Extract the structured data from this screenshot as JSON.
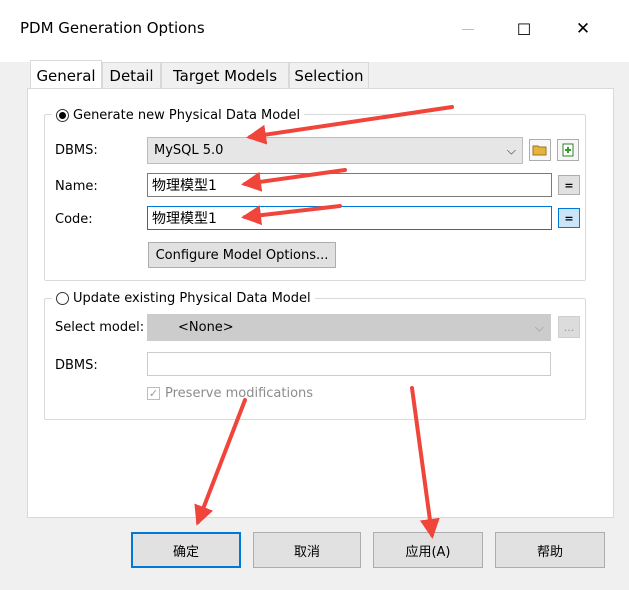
{
  "window": {
    "title": "PDM Generation Options",
    "controls": {
      "minimize": "—",
      "maximize": "☐",
      "close": "✕"
    }
  },
  "tabs": [
    {
      "label": "General"
    },
    {
      "label": "Detail"
    },
    {
      "label": "Target Models"
    },
    {
      "label": "Selection"
    }
  ],
  "generate_new": {
    "legend": "Generate new Physical Data Model",
    "selected": true,
    "dbms_label": "DBMS:",
    "dbms_value": "MySQL 5.0",
    "name_label": "Name:",
    "name_value": "物理模型1",
    "name_eq": "=",
    "code_label": "Code:",
    "code_value": "物理模型1",
    "code_eq": "=",
    "configure_button": "Configure Model Options..."
  },
  "update_existing": {
    "legend": "Update existing Physical Data Model",
    "selected": false,
    "select_model_label": "Select model:",
    "select_model_value": "<None>",
    "browse_label": "...",
    "dbms_label": "DBMS:",
    "dbms_value": "",
    "preserve_label": "Preserve modifications",
    "preserve_checked": true
  },
  "buttons": {
    "ok": "确定",
    "cancel": "取消",
    "apply": "应用(A)",
    "help": "帮助"
  },
  "icons": {
    "folder": "folder-open-icon",
    "properties": "properties-icon",
    "dropdown": "chevron-down-icon"
  },
  "colors": {
    "annotation_arrow": "#f0453a",
    "focus_border": "#0078d7"
  }
}
